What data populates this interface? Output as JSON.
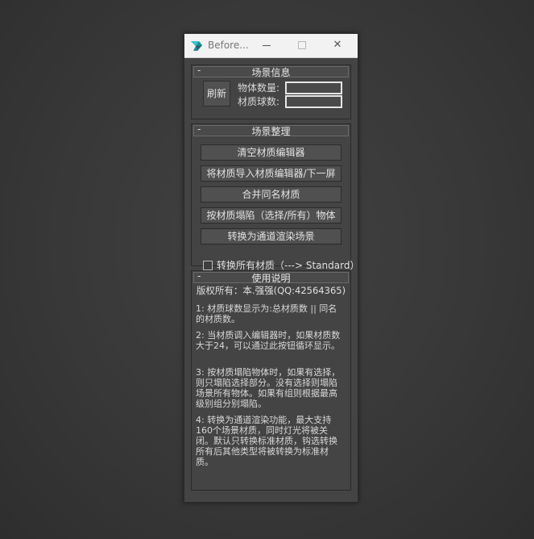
{
  "window": {
    "title": "Before...",
    "min_symbol": "",
    "close_symbol": "✕"
  },
  "scene_info": {
    "toggle": "-",
    "title": "场景信息",
    "refresh_label": "刷新",
    "object_count_label": "物体数量:",
    "material_count_label": "材质球数:",
    "object_count_value": "",
    "material_count_value": ""
  },
  "scene_cleanup": {
    "toggle": "-",
    "title": "场景整理",
    "buttons": [
      "清空材质编辑器",
      "将材质导入材质编辑器/下一屏",
      "合并同名材质",
      "按材质塌陷（选择/所有）物体",
      "转换为通道渲染场景"
    ],
    "checkbox_label": "转换所有材质（---> Standard）",
    "checkbox_checked": false
  },
  "usage": {
    "toggle": "-",
    "title": "使用说明",
    "copyright": "版权所有：本.强强(QQ:42564365)",
    "paragraphs": [
      "1: 材质球数显示为:总材质数 || 同名的材质数。",
      "2: 当材质调入编辑器时，如果材质数大于24，可以通过此按钮循环显示。",
      "3: 按材质塌陷物体时，如果有选择，则只塌陷选择部分。没有选择则塌陷场景所有物体。如果有组则根据最高级别组分别塌陷。",
      "4: 转换为通道渲染功能，最大支持160个场景材质，同时灯光将被关闭。默认只转换标准材质，钩选转换所有后其他类型将被转换为标准材质。"
    ]
  }
}
